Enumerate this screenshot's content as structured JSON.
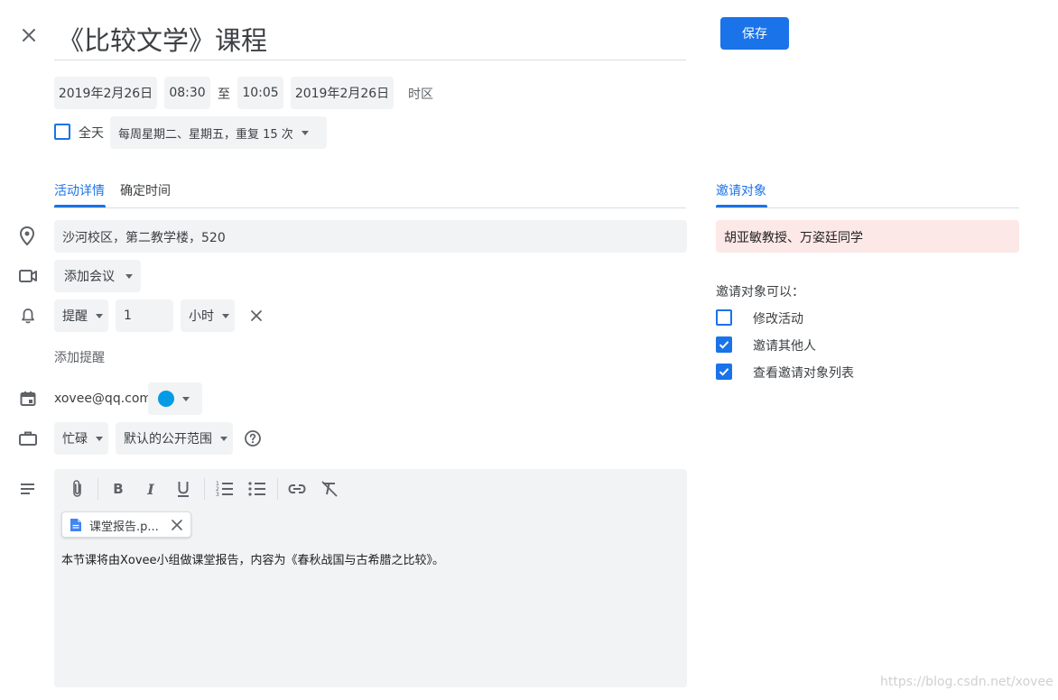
{
  "header": {
    "close_icon": "close-icon",
    "title": "《比较文学》课程",
    "save_label": "保存"
  },
  "datetime": {
    "start_date": "2019年2月26日",
    "start_time": "08:30",
    "to_label": "至",
    "end_time": "10:05",
    "end_date": "2019年2月26日",
    "timezone_label": "时区",
    "all_day_label": "全天",
    "all_day_checked": false,
    "recurrence": "每周星期二、星期五，重复 15 次"
  },
  "tabs": {
    "details": "活动详情",
    "find_time": "确定时间",
    "guests": "邀请对象"
  },
  "details": {
    "location_icon": "location-pin-icon",
    "location": "沙河校区，第二教学楼，520",
    "conference_icon": "video-camera-icon",
    "add_conference": "添加会议",
    "notification_icon": "bell-icon",
    "reminder_type": "提醒",
    "reminder_value": "1",
    "reminder_unit": "小时",
    "add_reminder": "添加提醒",
    "calendar_icon": "calendar-icon",
    "calendar_owner": "xovee@qq.com",
    "event_color": "#039be5",
    "status_icon": "briefcase-icon",
    "busy_status": "忙碌",
    "visibility": "默认的公开范围",
    "help_icon": "help-circle-icon",
    "description_icon": "notes-icon"
  },
  "editor": {
    "attachment_name": "课堂报告.p...",
    "attachment_icon": "document-icon",
    "body_text": "本节课将由Xovee小组做课堂报告，内容为《春秋战国与古希腊之比较》。",
    "toolbar": [
      "attach-icon",
      "bold-icon",
      "italic-icon",
      "underline-icon",
      "numbered-list-icon",
      "bulleted-list-icon",
      "link-icon",
      "clear-format-icon"
    ]
  },
  "guests": {
    "guest_list": "胡亚敏教授、万姿廷同学",
    "permissions_label": "邀请对象可以：",
    "permissions": [
      {
        "label": "修改活动",
        "checked": false
      },
      {
        "label": "邀请其他人",
        "checked": true
      },
      {
        "label": "查看邀请对象列表",
        "checked": true
      }
    ]
  },
  "watermark": "https://blog.csdn.net/xovee",
  "colors": {
    "accent": "#1a73e8",
    "chip_bg": "#f1f3f4",
    "guest_bg": "#fce8e6"
  }
}
